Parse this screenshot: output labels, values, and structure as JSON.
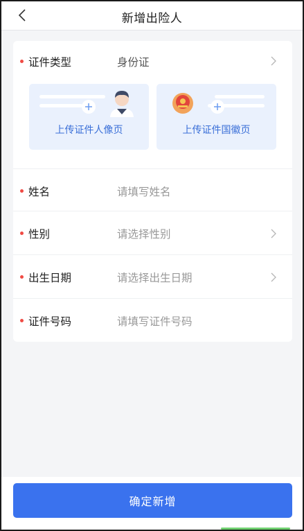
{
  "navbar": {
    "title": "新增出险人",
    "back_icon": "chevron-left-icon"
  },
  "form": {
    "id_type": {
      "label": "证件类型",
      "value": "身份证"
    },
    "upload": {
      "front_label": "上传证件人像页",
      "back_label": "上传证件国徽页"
    },
    "name": {
      "label": "姓名",
      "placeholder": "请填写姓名"
    },
    "gender": {
      "label": "性别",
      "placeholder": "请选择性别"
    },
    "birth": {
      "label": "出生日期",
      "placeholder": "请选择出生日期"
    },
    "id_number": {
      "label": "证件号码",
      "placeholder": "请填写证件号码"
    }
  },
  "footer": {
    "confirm_label": "确定新增"
  },
  "colors": {
    "accent": "#3a72ee",
    "required_dot": "#f04b44",
    "upload_bg": "#eaf1fd",
    "upload_text": "#3a6fd8",
    "page_bg": "#f4f5f7"
  }
}
